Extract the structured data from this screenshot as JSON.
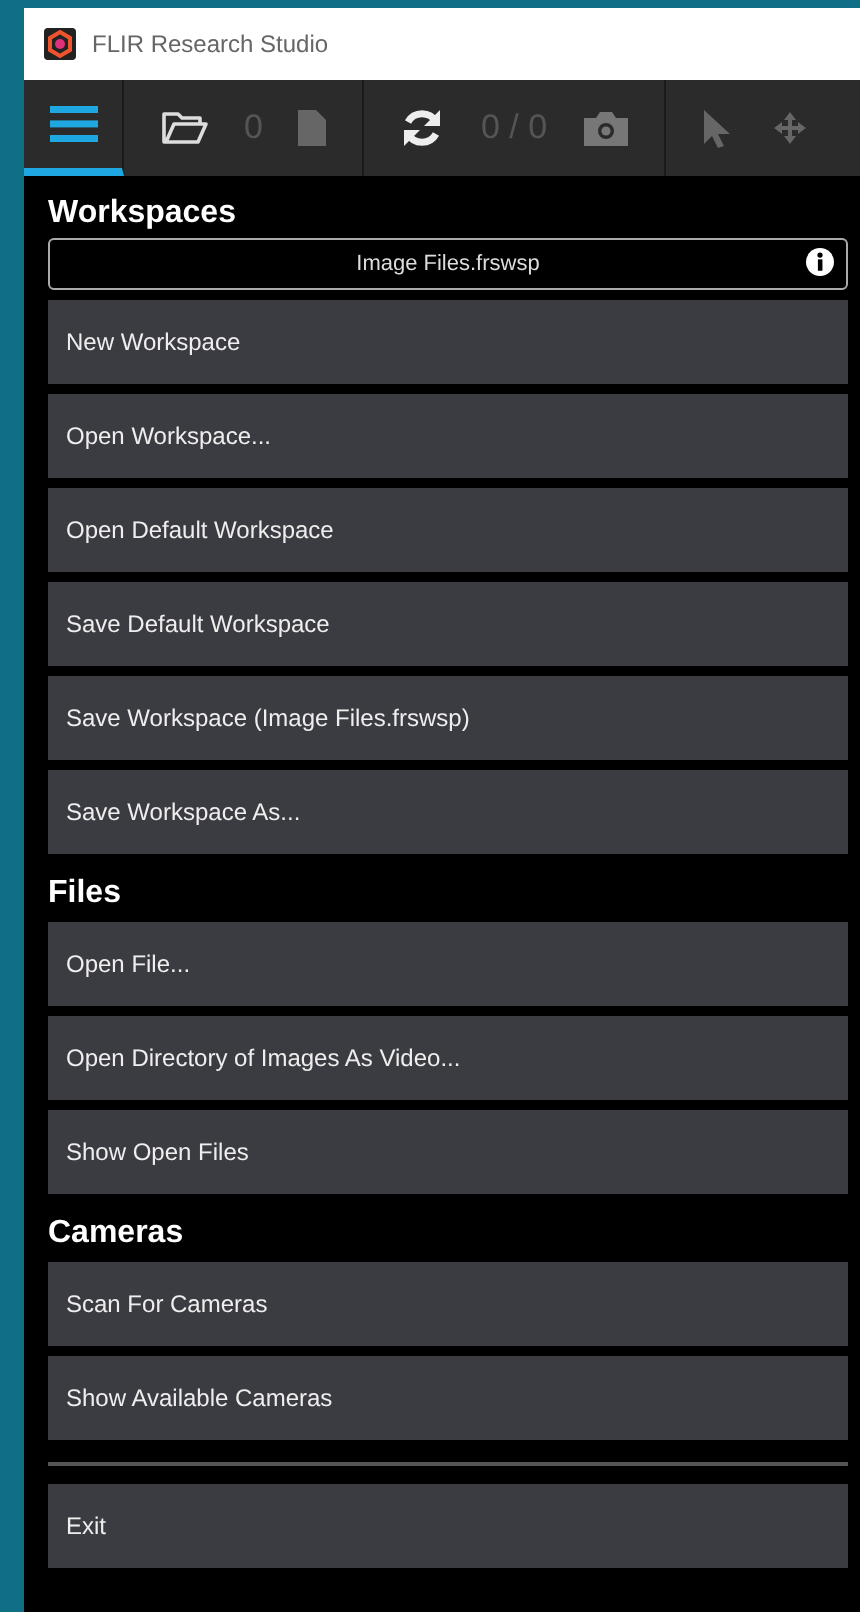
{
  "window": {
    "title": "FLIR Research Studio"
  },
  "toolbar": {
    "tabs": [
      {
        "kind": "menu",
        "selected": true
      }
    ],
    "file_count": "0",
    "camera_count": "0 / 0"
  },
  "workspace_file": {
    "value": "Image Files.frswsp"
  },
  "sections": [
    {
      "title": "Workspaces",
      "items": [
        "New Workspace",
        "Open Workspace...",
        "Open Default Workspace",
        "Save Default Workspace",
        "Save Workspace (Image Files.frswsp)",
        "Save Workspace As..."
      ]
    },
    {
      "title": "Files",
      "items": [
        "Open File...",
        "Open Directory of Images As Video...",
        "Show Open Files"
      ]
    },
    {
      "title": "Cameras",
      "items": [
        "Scan For Cameras",
        "Show Available Cameras"
      ]
    }
  ],
  "exit": "Exit"
}
